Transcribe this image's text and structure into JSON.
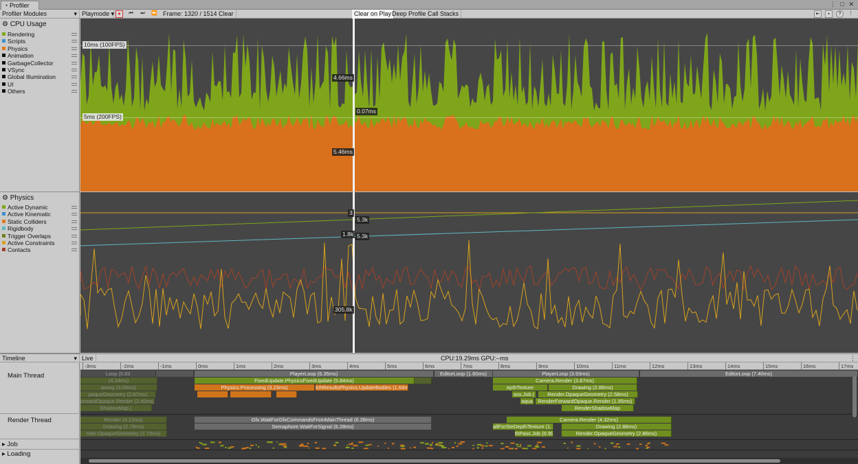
{
  "window": {
    "tab_title": "Profiler",
    "controls": "⋮ □ ✕"
  },
  "toolbar": {
    "modules_dropdown": "Profiler Modules",
    "target_dropdown": "Playmode",
    "frame_label": "Frame: 1320 / 1514",
    "clear": "Clear",
    "clear_on_play": "Clear on Play",
    "deep_profile": "Deep Profile",
    "call_stacks": "Call Stacks"
  },
  "cpu_module": {
    "title": "CPU Usage",
    "legend": [
      {
        "label": "Rendering",
        "color": "#7fa61a"
      },
      {
        "label": "Scripts",
        "color": "#3d8fcf"
      },
      {
        "label": "Physics",
        "color": "#e07a1c"
      },
      {
        "label": "Animation",
        "color": "#111111"
      },
      {
        "label": "GarbageCollector",
        "color": "#111111"
      },
      {
        "label": "VSync",
        "color": "#111111"
      },
      {
        "label": "Global Illumination",
        "color": "#111111"
      },
      {
        "label": "UI",
        "color": "#111111"
      },
      {
        "label": "Others",
        "color": "#111111"
      }
    ],
    "line_100fps": "10ms (100FPS)",
    "line_200fps": "5ms (200FPS)",
    "val_rendering": "4.66ms",
    "val_scripts": "0.07ms",
    "val_physics": "5.46ms"
  },
  "physics_module": {
    "title": "Physics",
    "legend": [
      {
        "label": "Active Dynamic",
        "color": "#7fa61a"
      },
      {
        "label": "Active Kinematic",
        "color": "#3d8fcf"
      },
      {
        "label": "Static Colliders",
        "color": "#e07a1c"
      },
      {
        "label": "Rigidbody",
        "color": "#5fb7c4"
      },
      {
        "label": "Trigger Overlaps",
        "color": "#6f7f1a"
      },
      {
        "label": "Active Constraints",
        "color": "#d9a21c"
      },
      {
        "label": "Contacts",
        "color": "#a0422a"
      }
    ],
    "val_3": "3",
    "val_5_3k_a": "5.3k",
    "val_1_8k": "1.8k",
    "val_5_3k_b": "5.3k",
    "val_305_8k": "305.8k"
  },
  "timeline": {
    "view_dropdown": "Timeline",
    "live": "Live",
    "stats": "CPU:19.29ms   GPU:--ms",
    "ruler": [
      "-3ms",
      "-2ms",
      "-1ms",
      "0ms",
      "1ms",
      "2ms",
      "3ms",
      "4ms",
      "5ms",
      "6ms",
      "7ms",
      "8ms",
      "9ms",
      "10ms",
      "11ms",
      "12ms",
      "13ms",
      "14ms",
      "15ms",
      "16ms",
      "17ms"
    ],
    "threads": {
      "main": "Main Thread",
      "render": "Render Thread",
      "job": "Job",
      "loading": "Loading"
    },
    "main_blocks": {
      "b1": "PlayerLoop (6.35ms)",
      "b2": "EditorLoop (1.60ms)",
      "b3": "PlayerLoop (3.93ms)",
      "b4": "EditorLoop (7.40ms)",
      "b5": "FixedUpdate.PhysicsFixedUpdate (5.84ms)",
      "b6": "Camera.Render (3.87ms)",
      "b7": "Physics.Processing (3.23ms)",
      "b8": "tchResultsPhysics.UpdateBodies (1.64ms)",
      "b9": "Drawing (2.88ms)",
      "b10": "Render.OpaqueGeometry (2.58ms)",
      "b11": "RenderForwardOpaque.Render (1.95ms)",
      "b12": "RenderShadowMap",
      "b13": "(4.32ms)",
      "b14": "(4.24ms)",
      "b15": "awing (3.09ms)",
      "b16": "paqueGeometry (2.87ms)",
      "b17": "orwardOpaque.Render (2.40ms)",
      "b18": "ShadowMap (",
      "b19": "epthTexture",
      "b20": "ass.Job (",
      "b21": "aqua",
      "b22": "Loop (0.83"
    },
    "render_blocks": {
      "r1": "Render (4.12ms)",
      "r2": "Drawing (2.79ms)",
      "r3": "nder.OpaqueGeometry (2.73ms)",
      "r4": "Gfx.WaitForGfxCommandsFromMainThread (6.28ms)",
      "r5": "Semaphore.WaitForSignal (6.28ms)",
      "r6": "Camera.Render (4.32ms)",
      "r7": "Drawing (2.88ms)",
      "r8": "Render.OpaqueGeometry (2.86ms)",
      "r9": "allForSteDepthTexture (1.1",
      "r10": "thPass.Job (0.99"
    }
  }
}
